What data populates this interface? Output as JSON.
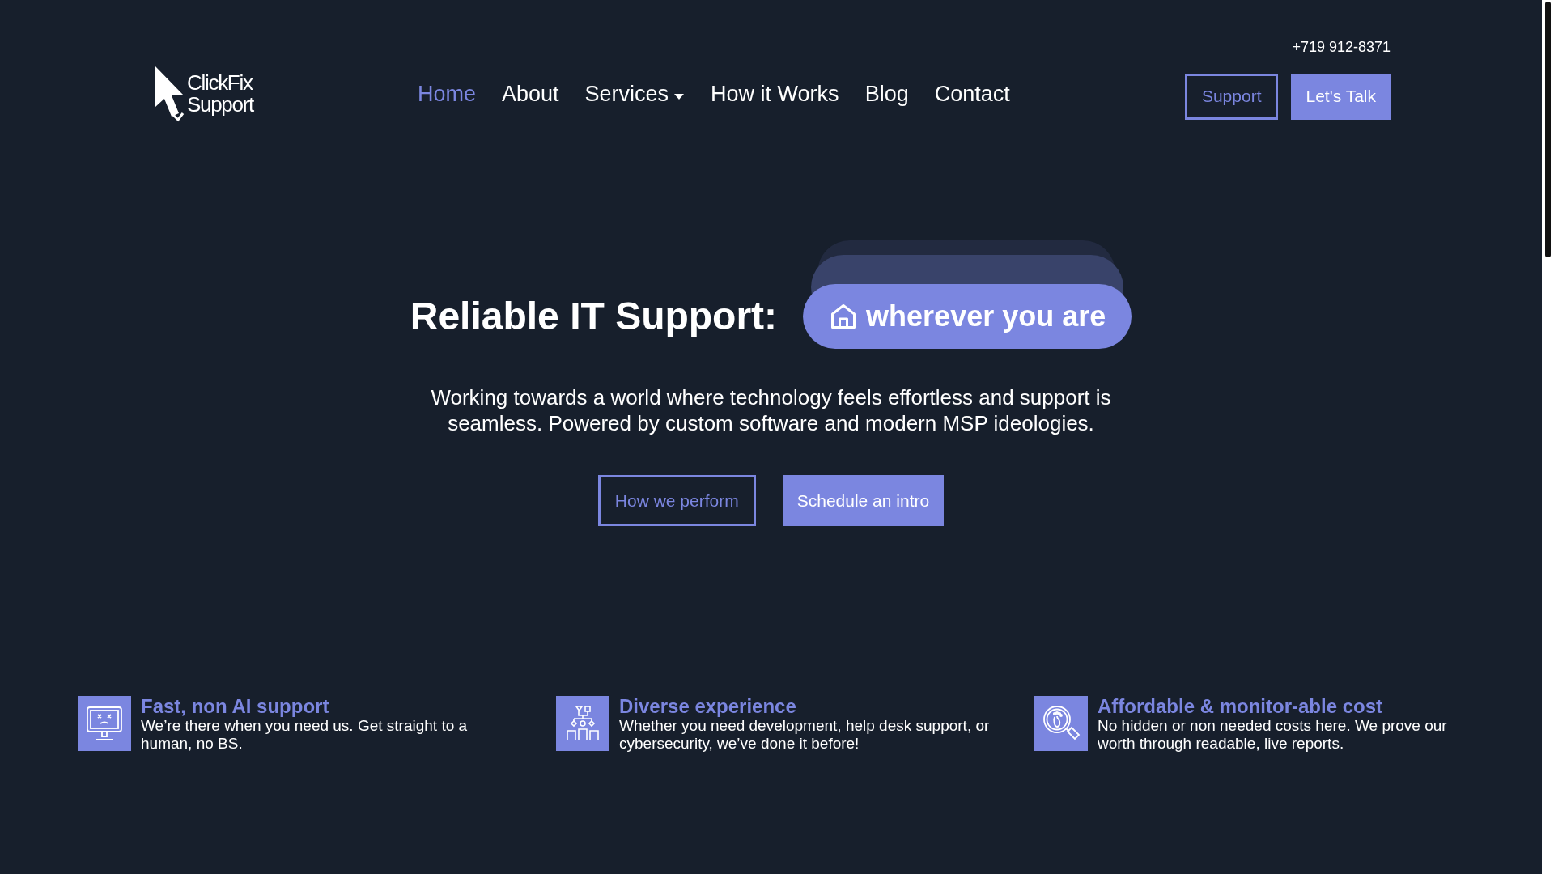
{
  "header": {
    "phone": "+719 912-8371",
    "logo": {
      "line_1": "ClickFix",
      "line_2": "Support"
    },
    "nav": [
      {
        "label": "Home",
        "selected": true,
        "dropdown": false
      },
      {
        "label": "About",
        "selected": false,
        "dropdown": false
      },
      {
        "label": "Services",
        "selected": false,
        "dropdown": true
      },
      {
        "label": "How it Works",
        "selected": false,
        "dropdown": false
      },
      {
        "label": "Blog",
        "selected": false,
        "dropdown": false
      },
      {
        "label": "Contact",
        "selected": false,
        "dropdown": false
      }
    ],
    "buttons": [
      {
        "label": "Support",
        "kind": "outline"
      },
      {
        "label": "Let's Talk",
        "kind": "filled"
      }
    ]
  },
  "hero": {
    "heading": "Reliable IT Support:",
    "rotating_phrase": "wherever you are",
    "description": "Working towards a world where technology feels effortless and support is seamless. Powered by custom software and modern MSP ideologies.",
    "buttons": [
      {
        "label": "How we perform",
        "kind": "outline"
      },
      {
        "label": "Schedule an intro",
        "kind": "filled"
      }
    ]
  },
  "features": [
    {
      "kind": "monitor",
      "title": "Fast, non AI support",
      "text": "We’re there when you need us. Get straight to a human, no BS."
    },
    {
      "kind": "team",
      "title": "Diverse experience",
      "text": "Whether you need development, help desk support, or cybersecurity, we’ve done it before!"
    },
    {
      "kind": "search",
      "title": "Affordable & monitor-able cost",
      "text": "No hidden or non needed costs here. We prove our worth through readable, live reports."
    }
  ]
}
